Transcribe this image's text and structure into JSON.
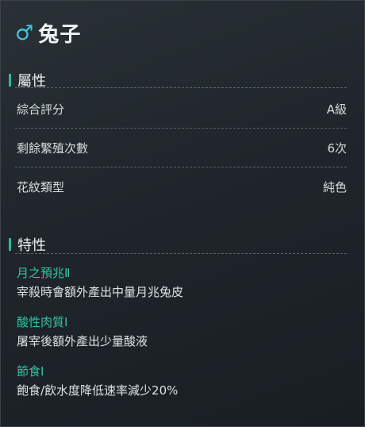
{
  "header": {
    "gender_icon": "♂",
    "name": "兔子"
  },
  "attributes": {
    "heading": "屬性",
    "rows": [
      {
        "label": "綜合評分",
        "value": "A級"
      },
      {
        "label": "剩餘繁殖次數",
        "value": "6次"
      },
      {
        "label": "花紋類型",
        "value": "純色"
      }
    ]
  },
  "traits": {
    "heading": "特性",
    "items": [
      {
        "name": "月之預兆Ⅱ",
        "description": "宰殺時會額外產出中量月兆兔皮"
      },
      {
        "name": "酸性肉質Ⅰ",
        "description": "屠宰後額外產出少量酸液"
      },
      {
        "name": "節食Ⅰ",
        "description": "飽食/飲水度降低速率減少20%"
      }
    ]
  },
  "colors": {
    "accent_gender": "#3fc6e0",
    "accent_trait": "#35c2a6",
    "background": "#1f252a"
  }
}
